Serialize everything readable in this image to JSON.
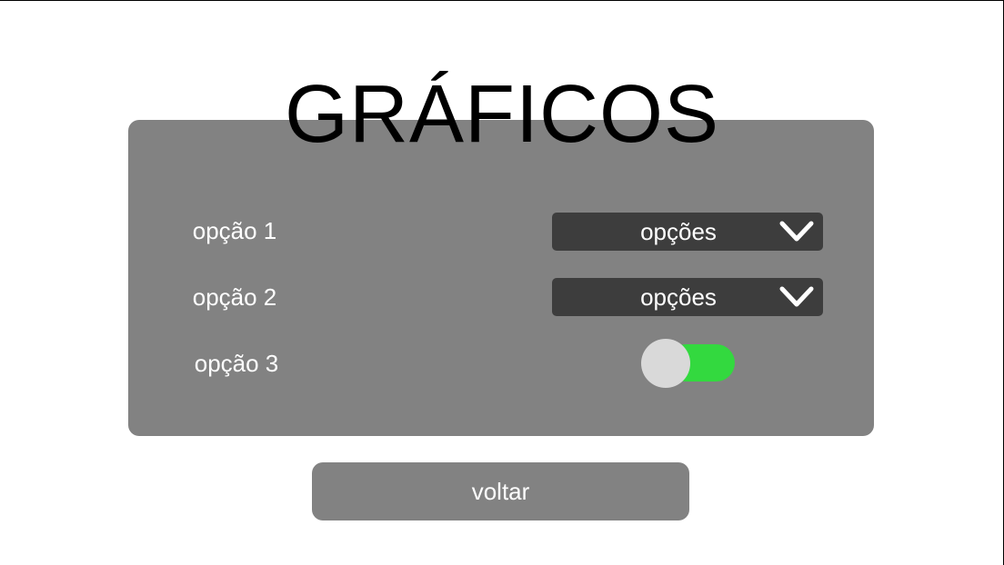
{
  "page": {
    "title": "GRÁFICOS"
  },
  "settings": {
    "items": [
      {
        "label": "opção 1",
        "control": "dropdown",
        "value": "opções",
        "icon": "chevron-down-icon"
      },
      {
        "label": "opção 2",
        "control": "dropdown",
        "value": "opções",
        "icon": "chevron-down-icon"
      },
      {
        "label": "opção 3",
        "control": "toggle",
        "value": true
      }
    ]
  },
  "footer": {
    "back_label": "voltar"
  },
  "colors": {
    "background": "#ffffff",
    "panel": "#828282",
    "dropdown": "#3d3d3d",
    "toggle_on": "#33d93f",
    "toggle_knob": "#d9d9d9",
    "text_light": "#ffffff",
    "title_text": "#000000"
  }
}
